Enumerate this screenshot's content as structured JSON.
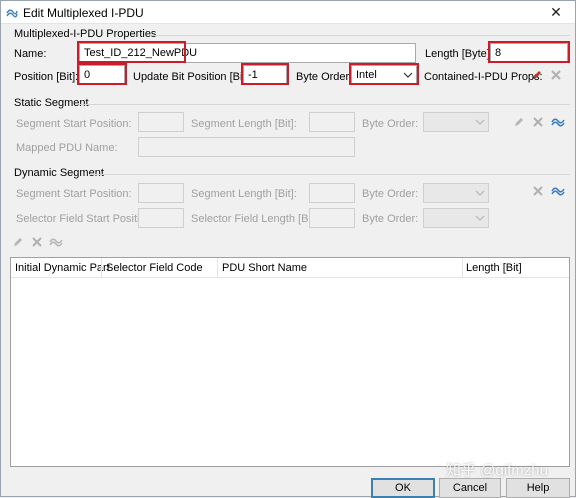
{
  "window": {
    "title": "Edit Multiplexed I-PDU",
    "close_glyph": "✕"
  },
  "properties": {
    "group_title": "Multiplexed-I-PDU Properties",
    "name_label": "Name:",
    "name_value": "Test_ID_212_NewPDU",
    "length_label": "Length [Byte]:",
    "length_value": "8",
    "position_label": "Position [Bit]:",
    "position_value": "0",
    "update_bit_label": "Update Bit Position [Bit]:",
    "update_bit_value": "-1",
    "byte_order_label": "Byte Order:",
    "byte_order_value": "Intel",
    "contained_label": "Contained-I-PDU Props:"
  },
  "static_segment": {
    "group_title": "Static Segment",
    "start_label": "Segment Start Position:",
    "length_label": "Segment Length [Bit]:",
    "byte_order_label": "Byte Order:",
    "mapped_pdu_label": "Mapped PDU Name:"
  },
  "dynamic_segment": {
    "group_title": "Dynamic Segment",
    "start_label": "Segment Start Position:",
    "length_label": "Segment Length [Bit]:",
    "byte_order_label": "Byte Order:",
    "selector_start_label": "Selector Field Start Position:",
    "selector_length_label": "Selector Field Length [Bit]:",
    "byte_order2_label": "Byte Order:"
  },
  "table": {
    "columns": [
      "Initial Dynamic Part",
      "Selector Field Code",
      "PDU Short Name",
      "Length [Bit]"
    ]
  },
  "buttons": {
    "ok": "OK",
    "cancel": "Cancel",
    "help": "Help"
  },
  "watermark": "知乎 @qifmzhu",
  "colors": {
    "highlight": "#cc1b2a",
    "icon_blue": "#3b7dbf",
    "icon_red": "#c0392b"
  }
}
